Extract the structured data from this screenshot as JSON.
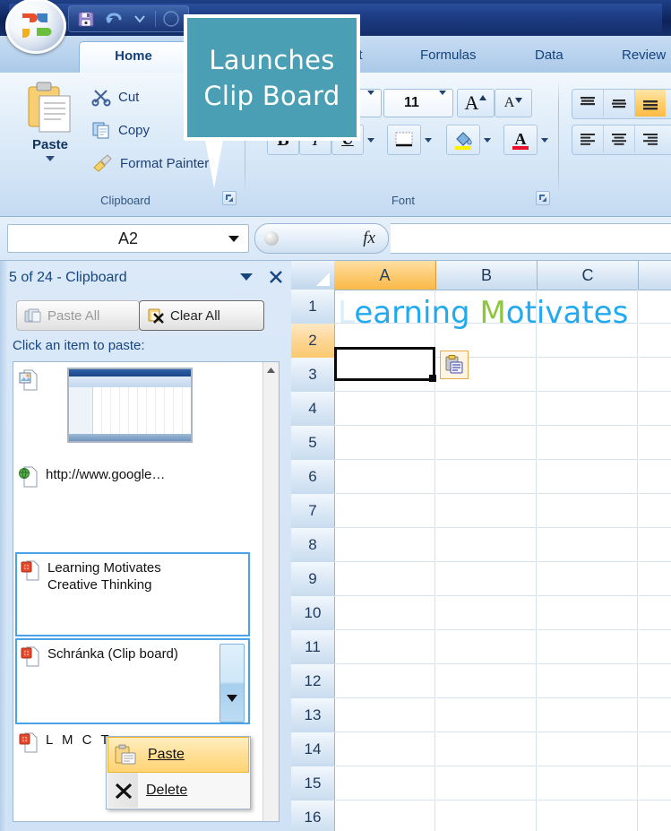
{
  "app": {
    "title_bar": {
      "office_button": "office-orb",
      "quick_access": [
        "save-icon",
        "undo-icon",
        "undo-dropdown-icon",
        "redo-icon"
      ]
    }
  },
  "ribbon": {
    "tabs": [
      {
        "label": "Home",
        "active": true
      },
      {
        "label": "ut",
        "active": false
      },
      {
        "label": "Formulas",
        "active": false
      },
      {
        "label": "Data",
        "active": false
      },
      {
        "label": "Review",
        "active": false
      }
    ],
    "clipboard_group": {
      "label": "Clipboard",
      "paste_label": "Paste",
      "commands": [
        {
          "label": "Cut",
          "icon": "scissors-icon"
        },
        {
          "label": "Copy",
          "icon": "copy-icon"
        },
        {
          "label": "Format Painter",
          "icon": "paintbrush-icon"
        }
      ],
      "dialog_launcher": "dialog-launcher-icon"
    },
    "font_group": {
      "label": "Font",
      "font_name": "",
      "font_size": "11",
      "grow_font": "A",
      "shrink_font": "A",
      "bold": "B",
      "italic": "I",
      "underline": "U",
      "borders_icon": "borders-icon",
      "fill_color_icon": "fill-color-icon",
      "font_color_icon": "font-color-icon",
      "dialog_launcher": "dialog-launcher-icon"
    },
    "alignment_group": {
      "top_align": "top-align-icon",
      "middle_align": "middle-align-icon",
      "bottom_align": "bottom-align-icon",
      "align_left": "align-left-icon",
      "align_center": "align-center-icon",
      "align_right": "align-right-icon"
    }
  },
  "formula_bar": {
    "name_box_value": "A2",
    "fx_label": "fx",
    "formula_value": ""
  },
  "clipboard_pane": {
    "title": "5 of 24 - Clipboard",
    "dropdown_icon": "chevron-down-icon",
    "close_icon": "close-icon",
    "paste_all_label": "Paste All",
    "clear_all_label": "Clear All",
    "hint": "Click an item to paste:",
    "items": [
      {
        "text": "",
        "icon": "image-doc-icon",
        "thumbnail": true,
        "selected": false
      },
      {
        "text": "http://www.google…",
        "icon": "web-doc-icon",
        "thumbnail": false,
        "selected": false
      },
      {
        "text": "Learning Motivates\nCreative Thinking",
        "icon": "office-doc-icon",
        "thumbnail": false,
        "selected": true
      },
      {
        "text": "Schránka (Clip board)",
        "icon": "office-doc-icon",
        "thumbnail": false,
        "selected": true
      },
      {
        "text": "L M C T",
        "icon": "office-doc-icon",
        "thumbnail": false,
        "selected": false
      }
    ]
  },
  "context_menu": {
    "items": [
      {
        "label": "Paste",
        "icon": "paste-icon",
        "highlighted": true
      },
      {
        "label": "Delete",
        "icon": "delete-x-icon",
        "highlighted": false
      }
    ]
  },
  "sheet": {
    "columns": [
      "A",
      "B",
      "C"
    ],
    "selected_column": "A",
    "rows": [
      "1",
      "2",
      "3",
      "4",
      "5",
      "6",
      "7",
      "8",
      "9",
      "10",
      "11",
      "12",
      "13",
      "14",
      "15",
      "16"
    ],
    "selected_row": "2",
    "active_cell": "A2",
    "cell_a1": {
      "segments": [
        {
          "text": "L",
          "color": "#d8eefb"
        },
        {
          "text": "earning ",
          "color": "#22aaf0"
        },
        {
          "text": "M",
          "color": "#8cc63f"
        },
        {
          "text": "otivates",
          "color": "#22aaf0"
        }
      ]
    },
    "paste_options_tag": "paste-options-icon"
  },
  "callout": {
    "line1": "Launches",
    "line2": "Clip Board",
    "color": "#4b9fb5",
    "text_color": "#ffffff"
  }
}
